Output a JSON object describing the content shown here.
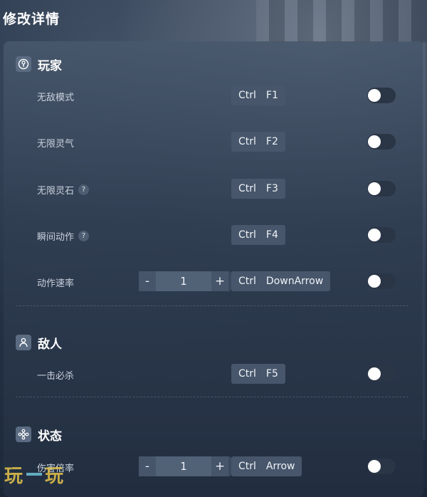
{
  "title": "修改详情",
  "sections": [
    {
      "title": "玩家",
      "icon": "player-icon",
      "rows": [
        {
          "label": "无敌模式",
          "has_help": false,
          "keys": [
            "Ctrl",
            "F1"
          ],
          "enabled": false
        },
        {
          "label": "无限灵气",
          "has_help": false,
          "keys": [
            "Ctrl",
            "F2"
          ],
          "enabled": false
        },
        {
          "label": "无限灵石",
          "has_help": true,
          "keys": [
            "Ctrl",
            "F3"
          ],
          "enabled": false
        },
        {
          "label": "瞬间动作",
          "has_help": true,
          "keys": [
            "Ctrl",
            "F4"
          ],
          "enabled": false
        },
        {
          "label": "动作速率",
          "has_help": false,
          "stepper": {
            "minus": "-",
            "value": "1",
            "plus": "+"
          },
          "keys": [
            "Ctrl",
            "DownArrow"
          ],
          "enabled": false
        }
      ]
    },
    {
      "title": "敌人",
      "icon": "enemy-icon",
      "rows": [
        {
          "label": "一击必杀",
          "has_help": false,
          "keys": [
            "Ctrl",
            "F5"
          ],
          "enabled": false
        }
      ]
    },
    {
      "title": "状态",
      "icon": "status-icon",
      "rows": [
        {
          "label": "伤害倍率",
          "has_help": false,
          "stepper": {
            "minus": "-",
            "value": "1",
            "plus": "+"
          },
          "keys": [
            "Ctrl",
            "Arrow"
          ],
          "enabled": false
        }
      ]
    }
  ],
  "help_glyph": "?",
  "watermark": {
    "left": "玩",
    "right": "玩"
  },
  "colors": {
    "accent_toggle_knob": "#ffffff",
    "panel_bg": "#3a4a60",
    "hotkey_bg": "#47566b",
    "watermark": "#e6c54a"
  }
}
